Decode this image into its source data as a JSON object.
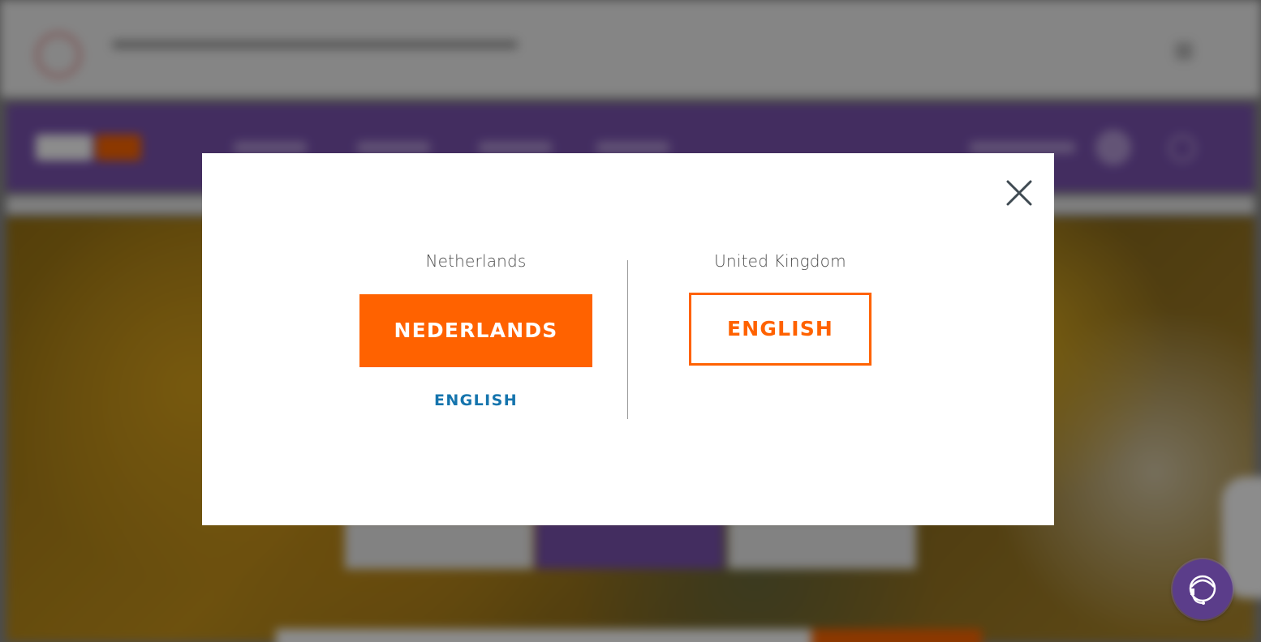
{
  "modal": {
    "close_icon": "close-icon",
    "left": {
      "country": "Netherlands",
      "primary_button": "NEDERLANDS",
      "secondary_link": "ENGLISH"
    },
    "right": {
      "country": "United Kingdom",
      "button": "ENGLISH"
    }
  },
  "chat": {
    "icon": "chat-agent-icon"
  },
  "colors": {
    "accent_orange": "#ff6200",
    "link_blue": "#1574ad",
    "brand_purple": "#5b3d8a"
  }
}
